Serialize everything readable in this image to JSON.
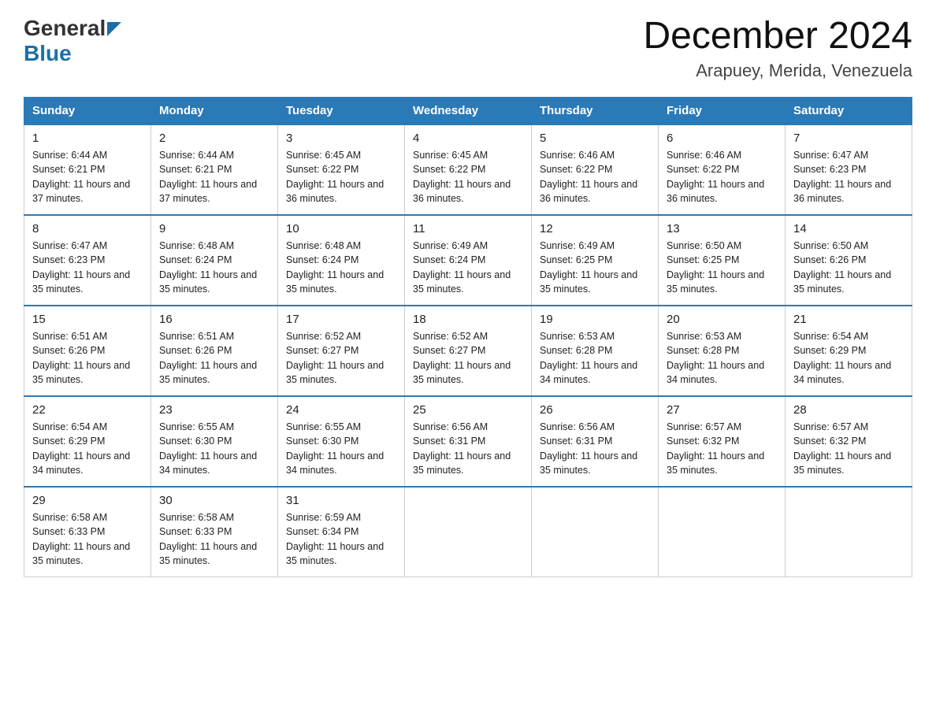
{
  "logo": {
    "general": "General",
    "blue": "Blue",
    "arrow_color": "#1a6fa8"
  },
  "header": {
    "month_year": "December 2024",
    "location": "Arapuey, Merida, Venezuela"
  },
  "columns": [
    "Sunday",
    "Monday",
    "Tuesday",
    "Wednesday",
    "Thursday",
    "Friday",
    "Saturday"
  ],
  "weeks": [
    [
      {
        "day": "1",
        "sunrise": "6:44 AM",
        "sunset": "6:21 PM",
        "daylight": "11 hours and 37 minutes."
      },
      {
        "day": "2",
        "sunrise": "6:44 AM",
        "sunset": "6:21 PM",
        "daylight": "11 hours and 37 minutes."
      },
      {
        "day": "3",
        "sunrise": "6:45 AM",
        "sunset": "6:22 PM",
        "daylight": "11 hours and 36 minutes."
      },
      {
        "day": "4",
        "sunrise": "6:45 AM",
        "sunset": "6:22 PM",
        "daylight": "11 hours and 36 minutes."
      },
      {
        "day": "5",
        "sunrise": "6:46 AM",
        "sunset": "6:22 PM",
        "daylight": "11 hours and 36 minutes."
      },
      {
        "day": "6",
        "sunrise": "6:46 AM",
        "sunset": "6:22 PM",
        "daylight": "11 hours and 36 minutes."
      },
      {
        "day": "7",
        "sunrise": "6:47 AM",
        "sunset": "6:23 PM",
        "daylight": "11 hours and 36 minutes."
      }
    ],
    [
      {
        "day": "8",
        "sunrise": "6:47 AM",
        "sunset": "6:23 PM",
        "daylight": "11 hours and 35 minutes."
      },
      {
        "day": "9",
        "sunrise": "6:48 AM",
        "sunset": "6:24 PM",
        "daylight": "11 hours and 35 minutes."
      },
      {
        "day": "10",
        "sunrise": "6:48 AM",
        "sunset": "6:24 PM",
        "daylight": "11 hours and 35 minutes."
      },
      {
        "day": "11",
        "sunrise": "6:49 AM",
        "sunset": "6:24 PM",
        "daylight": "11 hours and 35 minutes."
      },
      {
        "day": "12",
        "sunrise": "6:49 AM",
        "sunset": "6:25 PM",
        "daylight": "11 hours and 35 minutes."
      },
      {
        "day": "13",
        "sunrise": "6:50 AM",
        "sunset": "6:25 PM",
        "daylight": "11 hours and 35 minutes."
      },
      {
        "day": "14",
        "sunrise": "6:50 AM",
        "sunset": "6:26 PM",
        "daylight": "11 hours and 35 minutes."
      }
    ],
    [
      {
        "day": "15",
        "sunrise": "6:51 AM",
        "sunset": "6:26 PM",
        "daylight": "11 hours and 35 minutes."
      },
      {
        "day": "16",
        "sunrise": "6:51 AM",
        "sunset": "6:26 PM",
        "daylight": "11 hours and 35 minutes."
      },
      {
        "day": "17",
        "sunrise": "6:52 AM",
        "sunset": "6:27 PM",
        "daylight": "11 hours and 35 minutes."
      },
      {
        "day": "18",
        "sunrise": "6:52 AM",
        "sunset": "6:27 PM",
        "daylight": "11 hours and 35 minutes."
      },
      {
        "day": "19",
        "sunrise": "6:53 AM",
        "sunset": "6:28 PM",
        "daylight": "11 hours and 34 minutes."
      },
      {
        "day": "20",
        "sunrise": "6:53 AM",
        "sunset": "6:28 PM",
        "daylight": "11 hours and 34 minutes."
      },
      {
        "day": "21",
        "sunrise": "6:54 AM",
        "sunset": "6:29 PM",
        "daylight": "11 hours and 34 minutes."
      }
    ],
    [
      {
        "day": "22",
        "sunrise": "6:54 AM",
        "sunset": "6:29 PM",
        "daylight": "11 hours and 34 minutes."
      },
      {
        "day": "23",
        "sunrise": "6:55 AM",
        "sunset": "6:30 PM",
        "daylight": "11 hours and 34 minutes."
      },
      {
        "day": "24",
        "sunrise": "6:55 AM",
        "sunset": "6:30 PM",
        "daylight": "11 hours and 34 minutes."
      },
      {
        "day": "25",
        "sunrise": "6:56 AM",
        "sunset": "6:31 PM",
        "daylight": "11 hours and 35 minutes."
      },
      {
        "day": "26",
        "sunrise": "6:56 AM",
        "sunset": "6:31 PM",
        "daylight": "11 hours and 35 minutes."
      },
      {
        "day": "27",
        "sunrise": "6:57 AM",
        "sunset": "6:32 PM",
        "daylight": "11 hours and 35 minutes."
      },
      {
        "day": "28",
        "sunrise": "6:57 AM",
        "sunset": "6:32 PM",
        "daylight": "11 hours and 35 minutes."
      }
    ],
    [
      {
        "day": "29",
        "sunrise": "6:58 AM",
        "sunset": "6:33 PM",
        "daylight": "11 hours and 35 minutes."
      },
      {
        "day": "30",
        "sunrise": "6:58 AM",
        "sunset": "6:33 PM",
        "daylight": "11 hours and 35 minutes."
      },
      {
        "day": "31",
        "sunrise": "6:59 AM",
        "sunset": "6:34 PM",
        "daylight": "11 hours and 35 minutes."
      },
      null,
      null,
      null,
      null
    ]
  ],
  "labels": {
    "sunrise_prefix": "Sunrise: ",
    "sunset_prefix": "Sunset: ",
    "daylight_prefix": "Daylight: "
  }
}
